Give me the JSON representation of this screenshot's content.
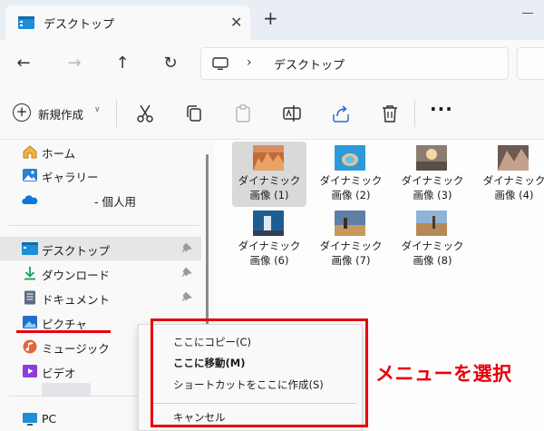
{
  "tab": {
    "title": "デスクトップ",
    "close": "✕",
    "new_tab": "+"
  },
  "nav": {
    "back": "←",
    "forward": "→",
    "up": "↑",
    "refresh": "↻",
    "separator": "›",
    "path": "デスクトップ"
  },
  "toolbar": {
    "new_label": "新規作成",
    "new_plus": "+",
    "new_chevron": "∨",
    "more": "···",
    "tools": [
      "scissors-icon",
      "copy-icon",
      "paste-icon",
      "rename-icon",
      "share-icon",
      "delete-icon"
    ]
  },
  "sidebar": {
    "items": [
      {
        "label": "ホーム",
        "icon": "home-icon"
      },
      {
        "label": "ギャラリー",
        "icon": "gallery-icon"
      },
      {
        "label": "- 個人用",
        "icon": "onedrive-icon"
      },
      {
        "label": "デスクトップ",
        "icon": "desktop-icon",
        "selected": true,
        "pinned": true
      },
      {
        "label": "ダウンロード",
        "icon": "download-icon",
        "pinned": true
      },
      {
        "label": "ドキュメント",
        "icon": "documents-icon",
        "pinned": true
      },
      {
        "label": "ピクチャ",
        "icon": "pictures-icon",
        "pinned": true
      },
      {
        "label": "ミュージック",
        "icon": "music-icon"
      },
      {
        "label": "ビデオ",
        "icon": "videos-icon"
      },
      {
        "label": "PC",
        "icon": "pc-icon"
      }
    ]
  },
  "files": [
    {
      "line1": "ダイナミック",
      "line2": "画像 (1)",
      "selected": true
    },
    {
      "line1": "ダイナミック",
      "line2": "画像 (2)"
    },
    {
      "line1": "ダイナミック",
      "line2": "画像 (3)"
    },
    {
      "line1": "ダイナミック",
      "line2": "画像 (4)"
    },
    {
      "line1": "ダイナミック",
      "line2": "画像 (6)"
    },
    {
      "line1": "ダイナミック",
      "line2": "画像 (7)"
    },
    {
      "line1": "ダイナミック",
      "line2": "画像 (8)"
    }
  ],
  "context_menu": {
    "items": [
      {
        "label": "ここにコピー(C)"
      },
      {
        "label": "ここに移動(M)",
        "bold": true
      },
      {
        "label": "ショートカットをここに作成(S)"
      },
      {
        "label": "キャンセル"
      }
    ]
  },
  "annotation": "メニューを選択",
  "colors": {
    "accent_red": "#e8000c",
    "selection": "#d9d9d9",
    "window_bg": "#f9f9f9"
  }
}
